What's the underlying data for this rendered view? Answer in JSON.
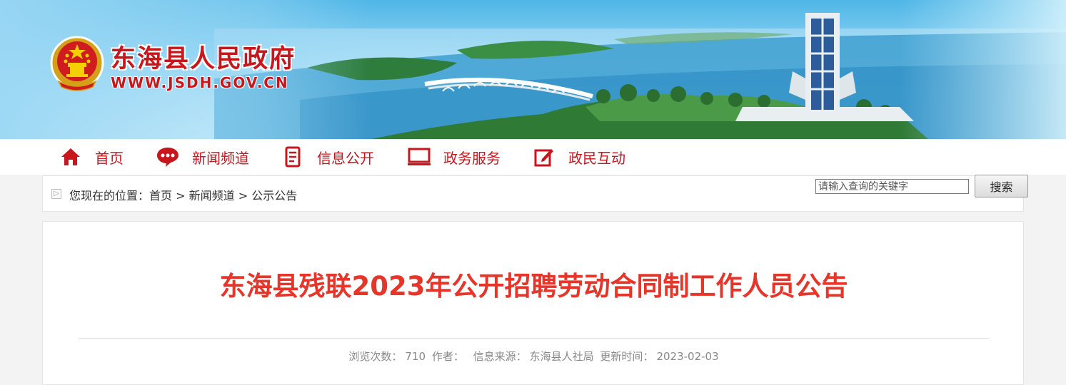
{
  "header": {
    "site_name": "东海县人民政府",
    "site_url": "WWW.JSDH.GOV.CN",
    "emblem_icon": "national-emblem-icon",
    "brand_color": "#c8161d"
  },
  "nav": {
    "items": [
      {
        "label": "首页",
        "icon": "home-icon"
      },
      {
        "label": "新闻频道",
        "icon": "chat-bubble-icon"
      },
      {
        "label": "信息公开",
        "icon": "document-icon"
      },
      {
        "label": "政务服务",
        "icon": "monitor-icon"
      },
      {
        "label": "政民互动",
        "icon": "edit-icon"
      }
    ]
  },
  "breadcrumb": {
    "prefix": "您现在的位置：",
    "home": "首页",
    "sep1": " > ",
    "channel": "新闻频道",
    "sep2": " > ",
    "current": "公示公告"
  },
  "search": {
    "placeholder": "请输入查询的关键字",
    "button_label": "搜索"
  },
  "article": {
    "title": "东海县残联2023年公开招聘劳动合同制工作人员公告",
    "title_color": "#e8352a",
    "views_label": "浏览次数：",
    "views": "710",
    "author_label": "作者：",
    "author": "",
    "source_label": "信息来源：",
    "source": "东海县人社局",
    "updated_label": "更新时间：",
    "updated": "2023-02-03"
  }
}
